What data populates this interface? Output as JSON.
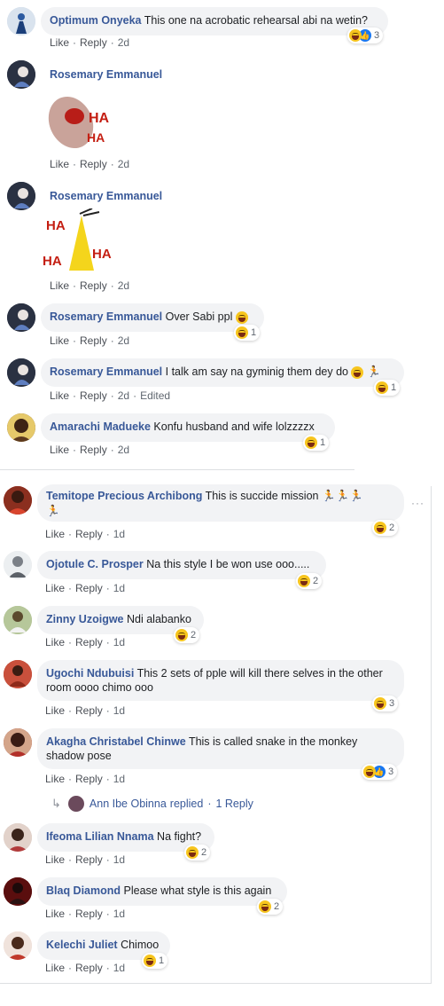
{
  "actions": {
    "like": "Like",
    "reply": "Reply",
    "dot": "·"
  },
  "comments": [
    {
      "author": "Optimum Onyeka",
      "text": "This one na acrobatic rehearsal abi na wetin?",
      "time": "2d",
      "reactions": "3"
    },
    {
      "author": "Rosemary Emmanuel",
      "text": "",
      "time": "2d",
      "sticker": "HA HA (laughing dog sticker)"
    },
    {
      "author": "Rosemary Emmanuel",
      "text": "",
      "time": "2d",
      "sticker": "HA HA HA (laughing bird sticker)"
    },
    {
      "author": "Rosemary Emmanuel",
      "text": "Over Sabi ppl",
      "time": "2d",
      "reactions": "1"
    },
    {
      "author": "Rosemary Emmanuel",
      "text": "I talk am say na gyminig them dey do",
      "time": "2d",
      "edited": "Edited",
      "reactions": "1"
    },
    {
      "author": "Amarachi Madueke",
      "text": "Konfu husband and wife lolzzzzx",
      "time": "2d",
      "reactions": "1"
    },
    {
      "author": "Temitope Precious Archibong",
      "text": "This is succide mission",
      "time": "1d",
      "reactions": "2"
    },
    {
      "author": "Ojotule C. Prosper",
      "text": "Na this style I be won use ooo.....",
      "time": "1d",
      "reactions": "2"
    },
    {
      "author": "Zinny Uzoigwe",
      "text": "Ndi alabanko",
      "time": "1d",
      "reactions": "2"
    },
    {
      "author": "Ugochi Ndubuisi",
      "text": "This 2 sets of pple will kill there selves in the other room oooo chimo ooo",
      "time": "1d",
      "reactions": "3"
    },
    {
      "author": "Akagha Christabel Chinwe",
      "text": "This is called snake in the monkey shadow pose",
      "time": "1d",
      "reactions": "3"
    },
    {
      "author": "Ifeoma Lilian Nnama",
      "text": "Na fight?",
      "time": "1d",
      "reactions": "2"
    },
    {
      "author": "Blaq Diamond",
      "text": "Please what style is this again",
      "time": "1d",
      "reactions": "2"
    },
    {
      "author": "Kelechi Juliet",
      "text": "Chimoo",
      "time": "1d",
      "reactions": "1"
    }
  ],
  "replies_row": {
    "replier": "Ann Ibe Obinna",
    "verb": "replied",
    "count_text": "1 Reply"
  },
  "more_icon": "···",
  "colors": {
    "link": "#385898",
    "bubble": "#f2f3f5",
    "meta": "#606770"
  }
}
